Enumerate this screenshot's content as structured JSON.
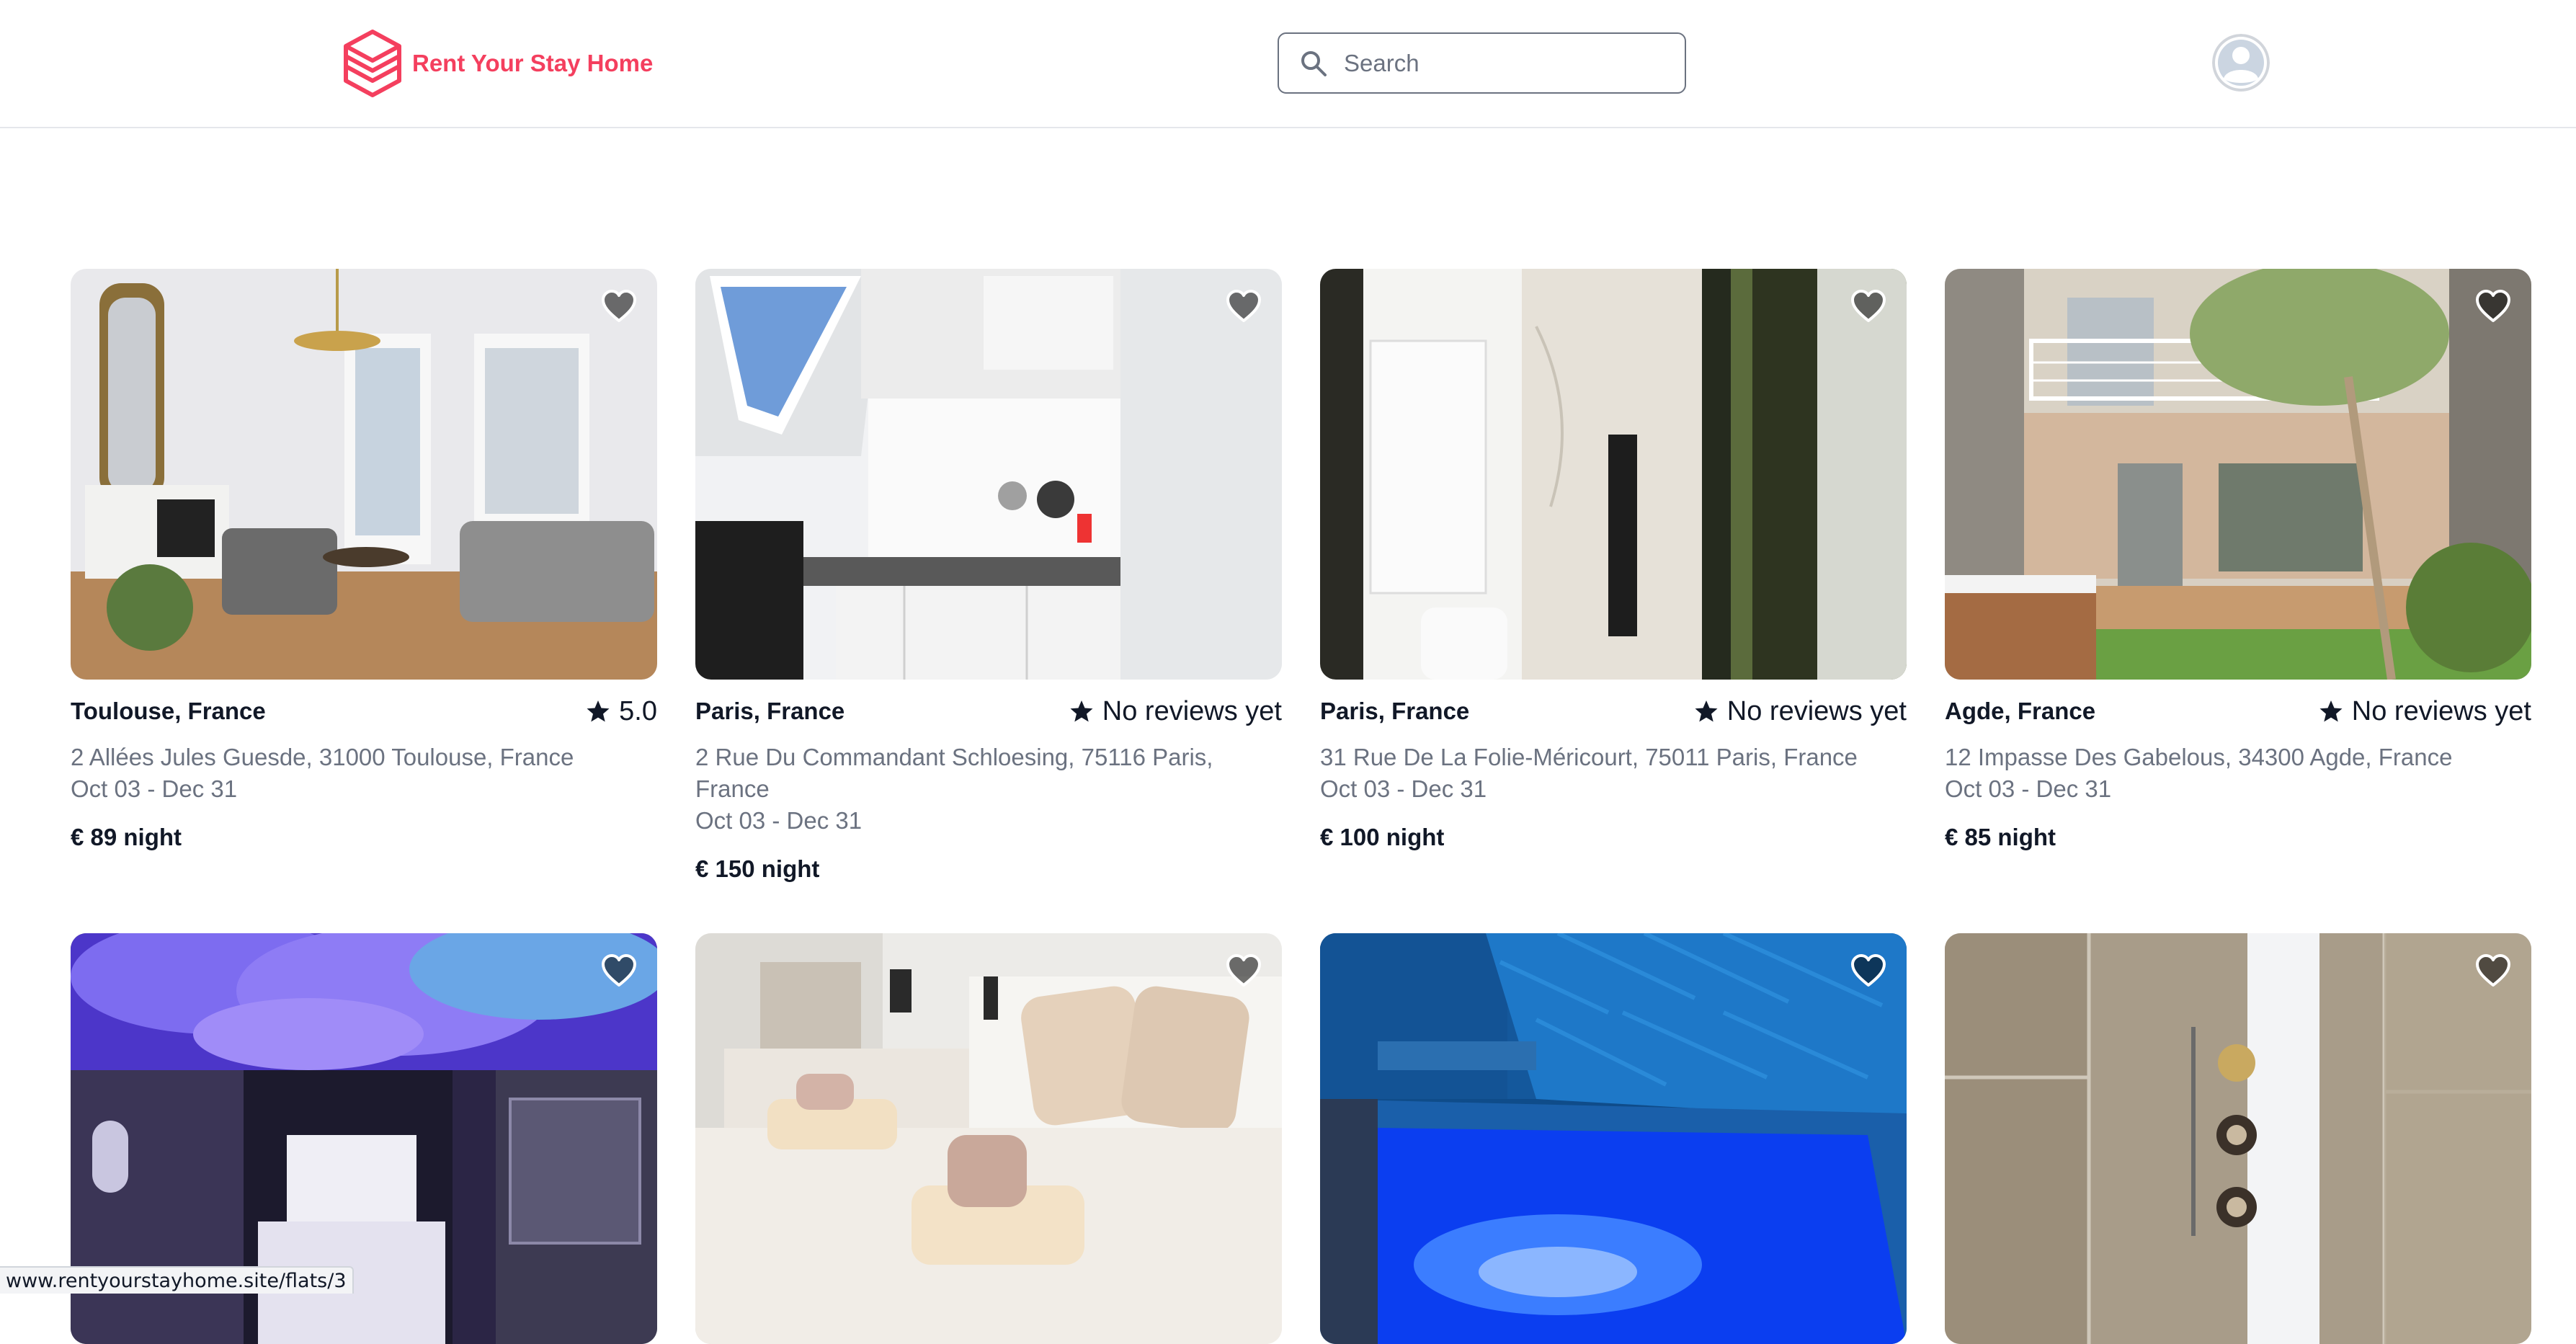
{
  "header": {
    "brand": "Rent Your Stay Home",
    "brand_color": "#f43f5e",
    "search_placeholder": "Search",
    "search_value": ""
  },
  "listings": [
    {
      "location": "Toulouse, France",
      "rating": "5.0",
      "address": "2 Allées Jules Guesde, 31000 Toulouse, France",
      "dates": "Oct 03 - Dec 31",
      "price": "€ 89 night",
      "photo": "living-room"
    },
    {
      "location": "Paris, France",
      "rating": "No reviews yet",
      "address": "2 Rue Du Commandant Schloesing, 75116 Paris, France",
      "dates": "Oct 03 - Dec 31",
      "price": "€ 150 night",
      "photo": "kitchen"
    },
    {
      "location": "Paris, France",
      "rating": "No reviews yet",
      "address": "31 Rue De La Folie-Méricourt, 75011 Paris, France",
      "dates": "Oct 03 - Dec 31",
      "price": "€ 100 night",
      "photo": "bathroom"
    },
    {
      "location": "Agde, France",
      "rating": "No reviews yet",
      "address": "12 Impasse Des Gabelous, 34300 Agde, France",
      "dates": "Oct 03 - Dec 31",
      "price": "€ 85 night",
      "photo": "terrace"
    },
    {
      "photo": "purple-bedroom"
    },
    {
      "photo": "bedroom"
    },
    {
      "photo": "blue-bathtub"
    },
    {
      "photo": "shower"
    }
  ],
  "status_url": "www.rentyourstayhome.site/flats/3",
  "icons": {
    "logo": "layered-cube-icon",
    "search": "search-icon",
    "avatar": "user-avatar-icon",
    "favorite": "heart-icon",
    "rating": "star-icon"
  }
}
